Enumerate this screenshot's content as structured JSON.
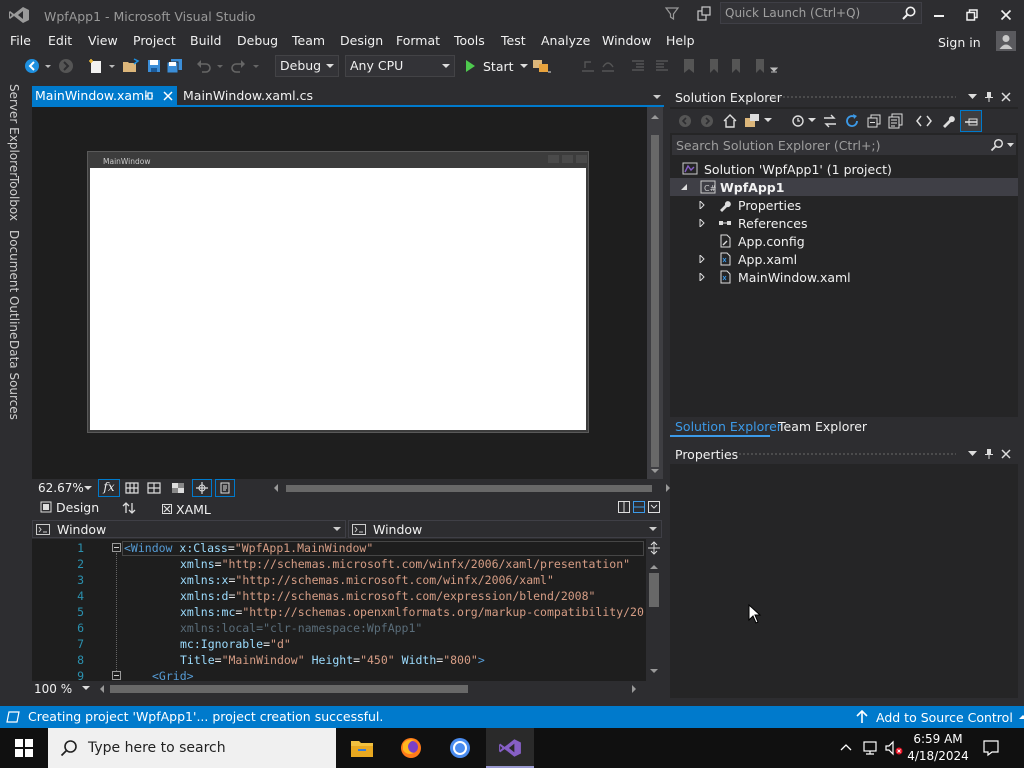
{
  "window": {
    "title": "WpfApp1 - Microsoft Visual Studio"
  },
  "quick_launch": {
    "placeholder": "Quick Launch (Ctrl+Q)"
  },
  "menu": {
    "items": [
      "File",
      "Edit",
      "View",
      "Project",
      "Build",
      "Debug",
      "Team",
      "Design",
      "Format",
      "Tools",
      "Test",
      "Analyze",
      "Window",
      "Help"
    ],
    "sign_in": "Sign in"
  },
  "toolbar": {
    "config": "Debug",
    "platform": "Any CPU",
    "start": "Start"
  },
  "left_tools": [
    "Server Explorer",
    "Toolbox",
    "Document Outline",
    "Data Sources"
  ],
  "doc_tabs": [
    {
      "label": "MainWindow.xaml"
    },
    {
      "label": "MainWindow.xaml.cs"
    }
  ],
  "designer": {
    "window_title": "MainWindow",
    "zoom": "62.67%",
    "fx": "fx"
  },
  "split": {
    "design": "Design",
    "xaml": "XAML"
  },
  "nav": {
    "left": "Window",
    "right": "Window"
  },
  "editor": {
    "line_numbers": [
      "1",
      "2",
      "3",
      "4",
      "5",
      "6",
      "7",
      "8",
      "9"
    ],
    "lines": [
      [
        [
          "tag",
          "<Window "
        ],
        [
          "attr",
          "x:Class"
        ],
        [
          "plain",
          "="
        ],
        [
          "val",
          "\"WpfApp1.MainWindow\""
        ]
      ],
      [
        [
          "attr",
          "xmlns"
        ],
        [
          "plain",
          "="
        ],
        [
          "val",
          "\"http://schemas.microsoft.com/winfx/2006/xaml/presentation\""
        ]
      ],
      [
        [
          "attr",
          "xmlns:x"
        ],
        [
          "plain",
          "="
        ],
        [
          "val",
          "\"http://schemas.microsoft.com/winfx/2006/xaml\""
        ]
      ],
      [
        [
          "attr",
          "xmlns:d"
        ],
        [
          "plain",
          "="
        ],
        [
          "val",
          "\"http://schemas.microsoft.com/expression/blend/2008\""
        ]
      ],
      [
        [
          "attr",
          "xmlns:mc"
        ],
        [
          "plain",
          "="
        ],
        [
          "val",
          "\"http://schemas.openxmlformats.org/markup-compatibility/20"
        ]
      ],
      [
        [
          "dim",
          "xmlns:local=\"clr-namespace:WpfApp1\""
        ]
      ],
      [
        [
          "attr",
          "mc:Ignorable"
        ],
        [
          "plain",
          "="
        ],
        [
          "val",
          "\"d\""
        ]
      ],
      [
        [
          "attr",
          "Title"
        ],
        [
          "plain",
          "="
        ],
        [
          "val",
          "\"MainWindow\""
        ],
        [
          "plain",
          " "
        ],
        [
          "attr",
          "Height"
        ],
        [
          "plain",
          "="
        ],
        [
          "val",
          "\"450\""
        ],
        [
          "plain",
          " "
        ],
        [
          "attr",
          "Width"
        ],
        [
          "plain",
          "="
        ],
        [
          "val",
          "\"800\""
        ],
        [
          "tag",
          ">"
        ]
      ],
      [
        [
          "tag",
          "<Grid>"
        ]
      ]
    ],
    "zoom": "100 %"
  },
  "solution_explorer": {
    "title": "Solution Explorer",
    "search_placeholder": "Search Solution Explorer (Ctrl+;)",
    "tree": [
      "Solution 'WpfApp1' (1 project)",
      "WpfApp1",
      "Properties",
      "References",
      "App.config",
      "App.xaml",
      "MainWindow.xaml"
    ],
    "tabs": [
      "Solution Explorer",
      "Team Explorer"
    ]
  },
  "properties": {
    "title": "Properties"
  },
  "status": {
    "message": "Creating project 'WpfApp1'... project creation successful.",
    "source_control": "Add to Source Control"
  },
  "taskbar": {
    "search_placeholder": "Type here to search",
    "time": "6:59 AM",
    "date": "4/18/2024"
  },
  "colors": {
    "accent": "#007acc",
    "chrome": "#2d2d30",
    "editor_bg": "#1e1e1e",
    "vs_purple": "#865fc5"
  }
}
